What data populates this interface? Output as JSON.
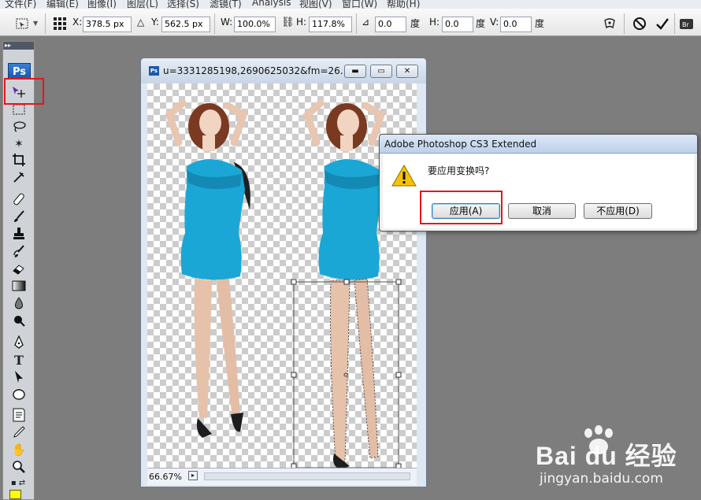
{
  "menubar": {
    "items": [
      "文件(F)",
      "编辑(E)",
      "图像(I)",
      "图层(L)",
      "选择(S)",
      "滤镜(T)",
      "Analysis",
      "视图(V)",
      "窗口(W)",
      "帮助(H)"
    ]
  },
  "options": {
    "x_label": "X:",
    "x_value": "378.5 px",
    "y_label": "Y:",
    "y_value": "562.5 px",
    "w_label": "W:",
    "w_value": "100.0%",
    "h_label": "H:",
    "h_value": "117.8%",
    "angle_value": "0.0",
    "angle_unit": "度",
    "hskew_label": "H:",
    "hskew_value": "0.0",
    "hskew_unit": "度",
    "vskew_label": "V:",
    "vskew_value": "0.0",
    "vskew_unit": "度"
  },
  "toolbox": {
    "logo": "Ps"
  },
  "document": {
    "title": "u=3331285198,2690625032&fm=26...",
    "zoom": "66.67%"
  },
  "dialog": {
    "title": "Adobe Photoshop CS3 Extended",
    "message": "要应用变换吗?",
    "apply_label": "应用(A)",
    "cancel_label": "取消",
    "dont_apply_label": "不应用(D)"
  },
  "watermark": {
    "brand": "Bai du 经验",
    "url": "jingyan.baidu.com"
  },
  "colors": {
    "highlight": "#e8141b",
    "dress": "#1aa7d6",
    "ps_blue": "#1b58a8",
    "foreground": "#ffff00"
  }
}
